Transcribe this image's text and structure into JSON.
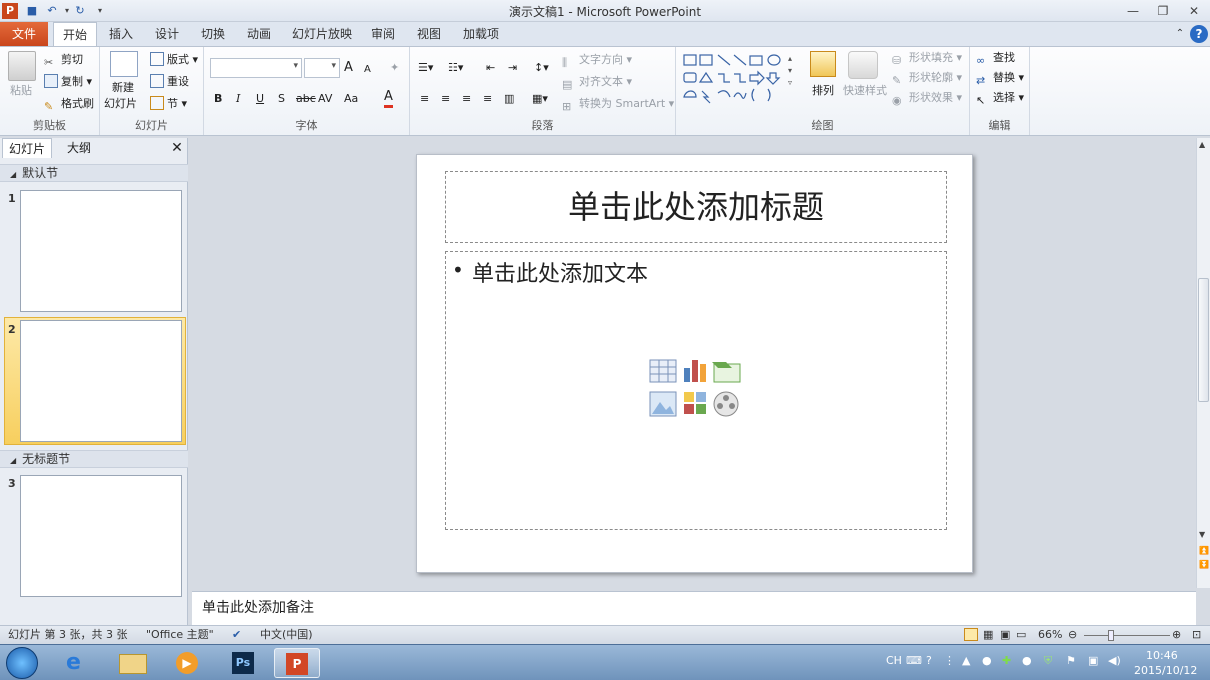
{
  "window": {
    "title": "演示文稿1 - Microsoft PowerPoint"
  },
  "tabs": {
    "file": "文件",
    "items": [
      "开始",
      "插入",
      "设计",
      "切换",
      "动画",
      "幻灯片放映",
      "审阅",
      "视图",
      "加载项"
    ],
    "active": "开始"
  },
  "ribbon": {
    "clipboard": {
      "label": "剪贴板",
      "paste": "粘贴",
      "cut": "剪切",
      "copy": "复制",
      "format_painter": "格式刷"
    },
    "slides": {
      "label": "幻灯片",
      "new_slide_line1": "新建",
      "new_slide_line2": "幻灯片",
      "layout": "版式",
      "reset": "重设",
      "section": "节"
    },
    "font": {
      "label": "字体",
      "bold": "B",
      "italic": "I",
      "underline": "U",
      "shadow": "S",
      "strike": "abc",
      "spacing": "AV",
      "case": "Aa",
      "grow": "A",
      "shrink": "A",
      "color": "A"
    },
    "paragraph": {
      "label": "段落",
      "text_direction": "文字方向",
      "align_text": "对齐文本",
      "smartart": "转换为 SmartArt"
    },
    "drawing": {
      "label": "绘图",
      "arrange": "排列",
      "quick_styles": "快速样式",
      "shape_fill": "形状填充",
      "shape_outline": "形状轮廓",
      "shape_effects": "形状效果"
    },
    "editing": {
      "label": "编辑",
      "find": "查找",
      "replace": "替换",
      "select": "选择"
    }
  },
  "leftpane": {
    "tab_slides": "幻灯片",
    "tab_outline": "大纲",
    "sections": [
      {
        "name": "默认节",
        "slides": [
          "1",
          "2"
        ]
      },
      {
        "name": "无标题节",
        "slides": [
          "3"
        ]
      }
    ],
    "selected_slide": "2"
  },
  "slide": {
    "title_placeholder": "单击此处添加标题",
    "body_bullet": "•",
    "body_placeholder": "单击此处添加文本"
  },
  "notes": {
    "placeholder": "单击此处添加备注"
  },
  "status": {
    "slide_info": "幻灯片 第 3 张，共 3 张",
    "theme": "\"Office 主题\"",
    "language": "中文(中国)",
    "zoom": "66%",
    "zoom_level": 66
  },
  "taskbar": {
    "ime": "CH",
    "time": "10:46",
    "date": "2015/10/12"
  },
  "colors": {
    "file_tab": "#c9461c",
    "selection": "#f7cf5e",
    "ribbon_bg": "#eef2f7"
  }
}
